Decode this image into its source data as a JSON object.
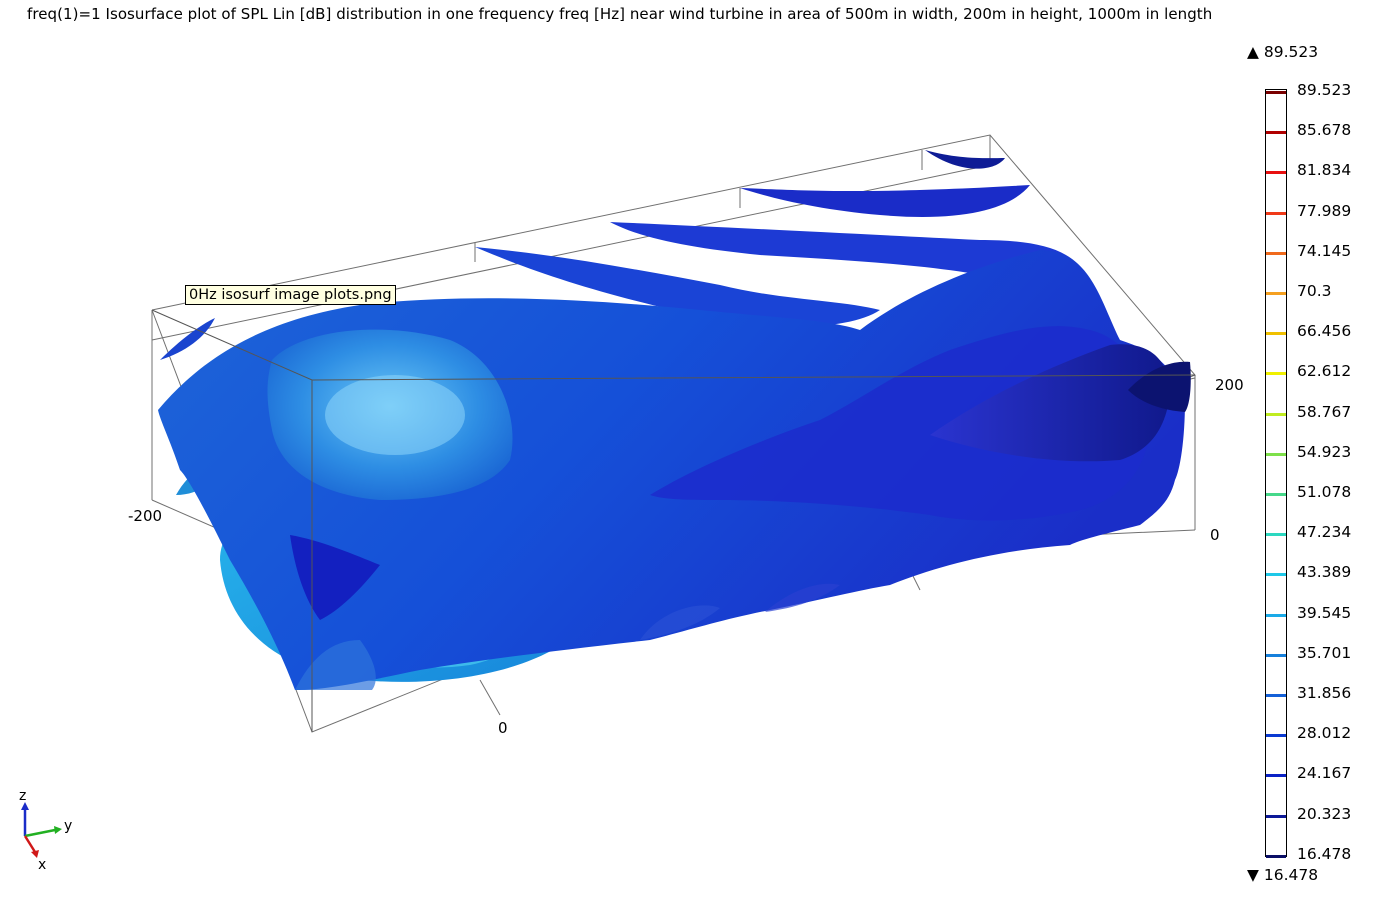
{
  "title": "freq(1)=1  Isosurface plot of SPL Lin [dB] distribution in one frequency freq [Hz] near wind turbine in area of 500m in width, 200m in height, 1000m in length",
  "tooltip": "0Hz isosurf image plots.png",
  "axis_ticks": {
    "left": "-200",
    "bottom": "0",
    "right_top": "200",
    "right_bottom": "0"
  },
  "triad": {
    "z": "z",
    "y": "y",
    "x": "x"
  },
  "legend": {
    "max_label": "▲ 89.523",
    "min_label": "▼ 16.478",
    "levels": [
      {
        "value": "89.523",
        "color": "#7a0000"
      },
      {
        "value": "85.678",
        "color": "#b00000"
      },
      {
        "value": "81.834",
        "color": "#e81010"
      },
      {
        "value": "77.989",
        "color": "#f03a18"
      },
      {
        "value": "74.145",
        "color": "#f06a1c"
      },
      {
        "value": "70.3",
        "color": "#f5a020"
      },
      {
        "value": "66.456",
        "color": "#f0c000"
      },
      {
        "value": "62.612",
        "color": "#f0f000"
      },
      {
        "value": "58.767",
        "color": "#c0ec20"
      },
      {
        "value": "54.923",
        "color": "#7ee04a"
      },
      {
        "value": "51.078",
        "color": "#46d88a"
      },
      {
        "value": "47.234",
        "color": "#2cd8c0"
      },
      {
        "value": "43.389",
        "color": "#1ec8e8"
      },
      {
        "value": "39.545",
        "color": "#1aaae8"
      },
      {
        "value": "35.701",
        "color": "#1680dc"
      },
      {
        "value": "31.856",
        "color": "#1460d8"
      },
      {
        "value": "28.012",
        "color": "#0a3ad2"
      },
      {
        "value": "24.167",
        "color": "#0a22c6"
      },
      {
        "value": "20.323",
        "color": "#0c1898"
      },
      {
        "value": "16.478",
        "color": "#0a0e66"
      }
    ]
  }
}
